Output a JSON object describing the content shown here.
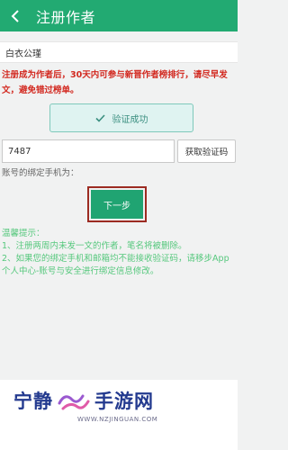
{
  "header": {
    "title": "注册作者",
    "back_icon": "back-chevron-icon"
  },
  "form": {
    "author_name": "白衣公瑾",
    "notice": "注册成为作者后，30天内可参与新晋作者榜排行，请尽早发文，避免错过榜单。",
    "verify_status": "验证成功",
    "code_value": "7487",
    "get_code_label": "获取验证码",
    "bind_label": "账号的绑定手机为：",
    "next_label": "下一步"
  },
  "tips": {
    "title": "温馨提示：",
    "items": [
      "1、注册两周内未发一文的作者，笔名将被删除。",
      "2、如果您的绑定手机和邮箱均不能接收验证码，请移步App个人中心-账号与安全进行绑定信息修改。"
    ]
  },
  "watermark": {
    "left_text": "宁静",
    "right_text": "手游网",
    "url": "WWW.NZJINGUAN.COM"
  },
  "colors": {
    "header_bg": "#22aa72",
    "notice_red": "#d2281f",
    "tips_green": "#56c87d",
    "next_button": "#20a472",
    "highlight_border": "#9c2b22",
    "watermark_blue": "#233a8f"
  }
}
